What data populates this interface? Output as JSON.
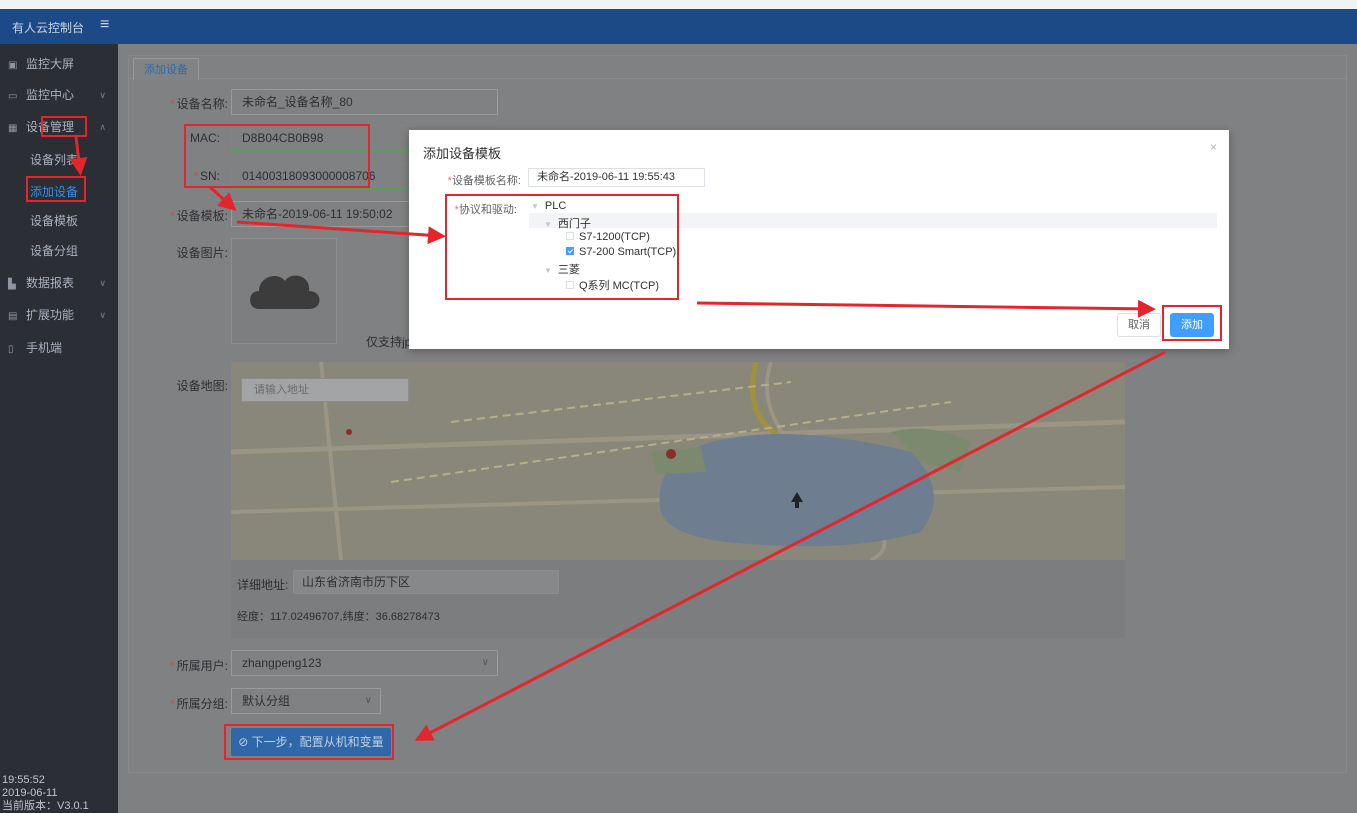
{
  "app": {
    "title": "有人云控制台"
  },
  "sidebar": {
    "items": [
      {
        "label": "监控大屏",
        "icon": "monitor-icon"
      },
      {
        "label": "监控中心",
        "icon": "display-icon"
      },
      {
        "label": "设备管理",
        "icon": "grid-icon"
      },
      {
        "label": "数据报表",
        "icon": "chart-icon"
      },
      {
        "label": "扩展功能",
        "icon": "extension-icon"
      },
      {
        "label": "手机端",
        "icon": "mobile-icon"
      }
    ],
    "subitems": [
      "设备列表",
      "添加设备",
      "设备模板",
      "设备分组"
    ],
    "footer": {
      "time": "19:55:52",
      "date": "2019-06-11",
      "version": "当前版本：V3.0.1"
    }
  },
  "tab": {
    "label": "添加设备"
  },
  "form": {
    "device_name": {
      "label": "设备名称:",
      "value": "未命名_设备名称_80"
    },
    "mac": {
      "label": "MAC:",
      "value": "D8B04CB0B98"
    },
    "sn": {
      "label": "SN:",
      "value": "01400318093000008706"
    },
    "template": {
      "label": "设备模板:",
      "value": "未命名-2019-06-11 19:50:02"
    },
    "image": {
      "label": "设备图片:",
      "support_text": "仅支持jpg,"
    },
    "map": {
      "label": "设备地图:",
      "search_placeholder": "请输入地址"
    },
    "detail": {
      "label": "详细地址:",
      "value": "山东省济南市历下区",
      "coords": "经度：117.02496707,纬度：36.68278473"
    },
    "owner": {
      "label": "所属用户:",
      "value": "zhangpeng123"
    },
    "group": {
      "label": "所属分组:",
      "value": "默认分组"
    },
    "next_button": "⊘ 下一步，配置从机和变量"
  },
  "modal": {
    "title": "添加设备模板",
    "close": "×",
    "name_label": "设备模板名称:",
    "name_value": "未命名-2019-06-11 19:55:43",
    "protocol_label": "协议和驱动:",
    "tree": {
      "root": "PLC",
      "groups": [
        {
          "label": "西门子",
          "children": [
            {
              "label": "S7-1200(TCP)",
              "checked": false
            },
            {
              "label": "S7-200 Smart(TCP)",
              "checked": true
            }
          ]
        },
        {
          "label": "三菱",
          "children": [
            {
              "label": "Q系列 MC(TCP)",
              "checked": false
            }
          ]
        }
      ]
    },
    "cancel": "取消",
    "add": "添加"
  },
  "colors": {
    "topbar": "#1b4a86",
    "sidebar": "#2b2e35",
    "overlay": "#7f8081",
    "primary": "#409eff",
    "annotation": "#e3262c"
  }
}
